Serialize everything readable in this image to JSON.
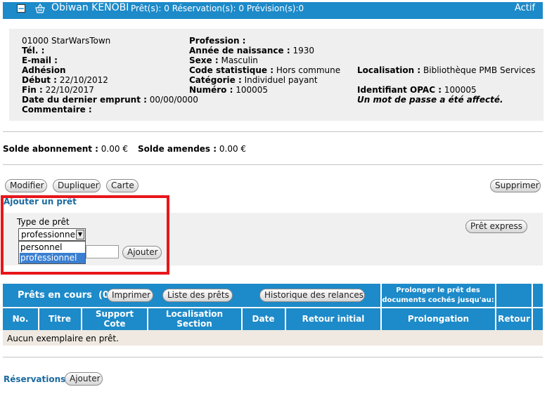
{
  "header": {
    "toggle": "−",
    "name": "Obiwan KENOBI",
    "stats": "Prêt(s): 0 Réservation(s): 0 Prévision(s):0",
    "status": "Actif"
  },
  "info": {
    "address": "01000 StarWarsTown",
    "tel_label": "Tél. :",
    "email_label": "E-mail :",
    "adhesion_label": "Adhésion",
    "debut_label": "Début :",
    "debut_value": "22/10/2012",
    "fin_label": "Fin :",
    "fin_value": "22/10/2017",
    "last_loan_label": "Date du dernier emprunt :",
    "last_loan_value": "00/00/0000",
    "comment_label": "Commentaire :",
    "profession_label": "Profession :",
    "birth_label": "Année de naissance :",
    "birth_value": "1930",
    "sexe_label": "Sexe :",
    "sexe_value": "Masculin",
    "code_label": "Code statistique :",
    "code_value": "Hors commune",
    "categorie_label": "Catégorie :",
    "categorie_value": "Individuel payant",
    "numero_label": "Numéro :",
    "numero_value": "100005",
    "localisation_label": "Localisation :",
    "localisation_value": "Bibliothèque PMB Services",
    "opac_label": "Identifiant OPAC :",
    "opac_value": "100005",
    "password_note": "Un mot de passe a été affecté."
  },
  "balances": {
    "abonnement_label": "Solde abonnement :",
    "abonnement_value": "0.00 €",
    "amendes_label": "Solde amendes :",
    "amendes_value": "0.00 €"
  },
  "actions": {
    "modifier": "Modifier",
    "dupliquer": "Dupliquer",
    "carte": "Carte",
    "supprimer": "Supprimer"
  },
  "add_loan": {
    "title": "Ajouter un prêt",
    "type_label": "Type de prêt",
    "selected": "professionnel",
    "options": [
      "personnel",
      "professionnel"
    ],
    "ajouter": "Ajouter",
    "pret_express": "Prêt express"
  },
  "loans_table": {
    "title": "Prêts en cours",
    "count": "(0)",
    "imprimer": "Imprimer",
    "liste": "Liste des prêts",
    "historique": "Historique des relances",
    "prolonger_line1": "Prolonger le prêt des",
    "prolonger_line2": "documents cochés jusqu'au:",
    "columns": {
      "no": "No.",
      "titre": "Titre",
      "support_1": "Support",
      "support_2": "Cote",
      "loc_1": "Localisation",
      "loc_2": "Section",
      "date": "Date",
      "retour_initial": "Retour initial",
      "prolongation": "Prolongation",
      "retour": "Retour"
    },
    "empty_message": "Aucun exemplaire en prêt."
  },
  "reservations": {
    "title": "Réservations",
    "ajouter": "Ajouter"
  },
  "colors": {
    "header_blue": "#1d8ac9",
    "title_blue": "#1a6aa0",
    "highlight_red": "#e8161b"
  }
}
